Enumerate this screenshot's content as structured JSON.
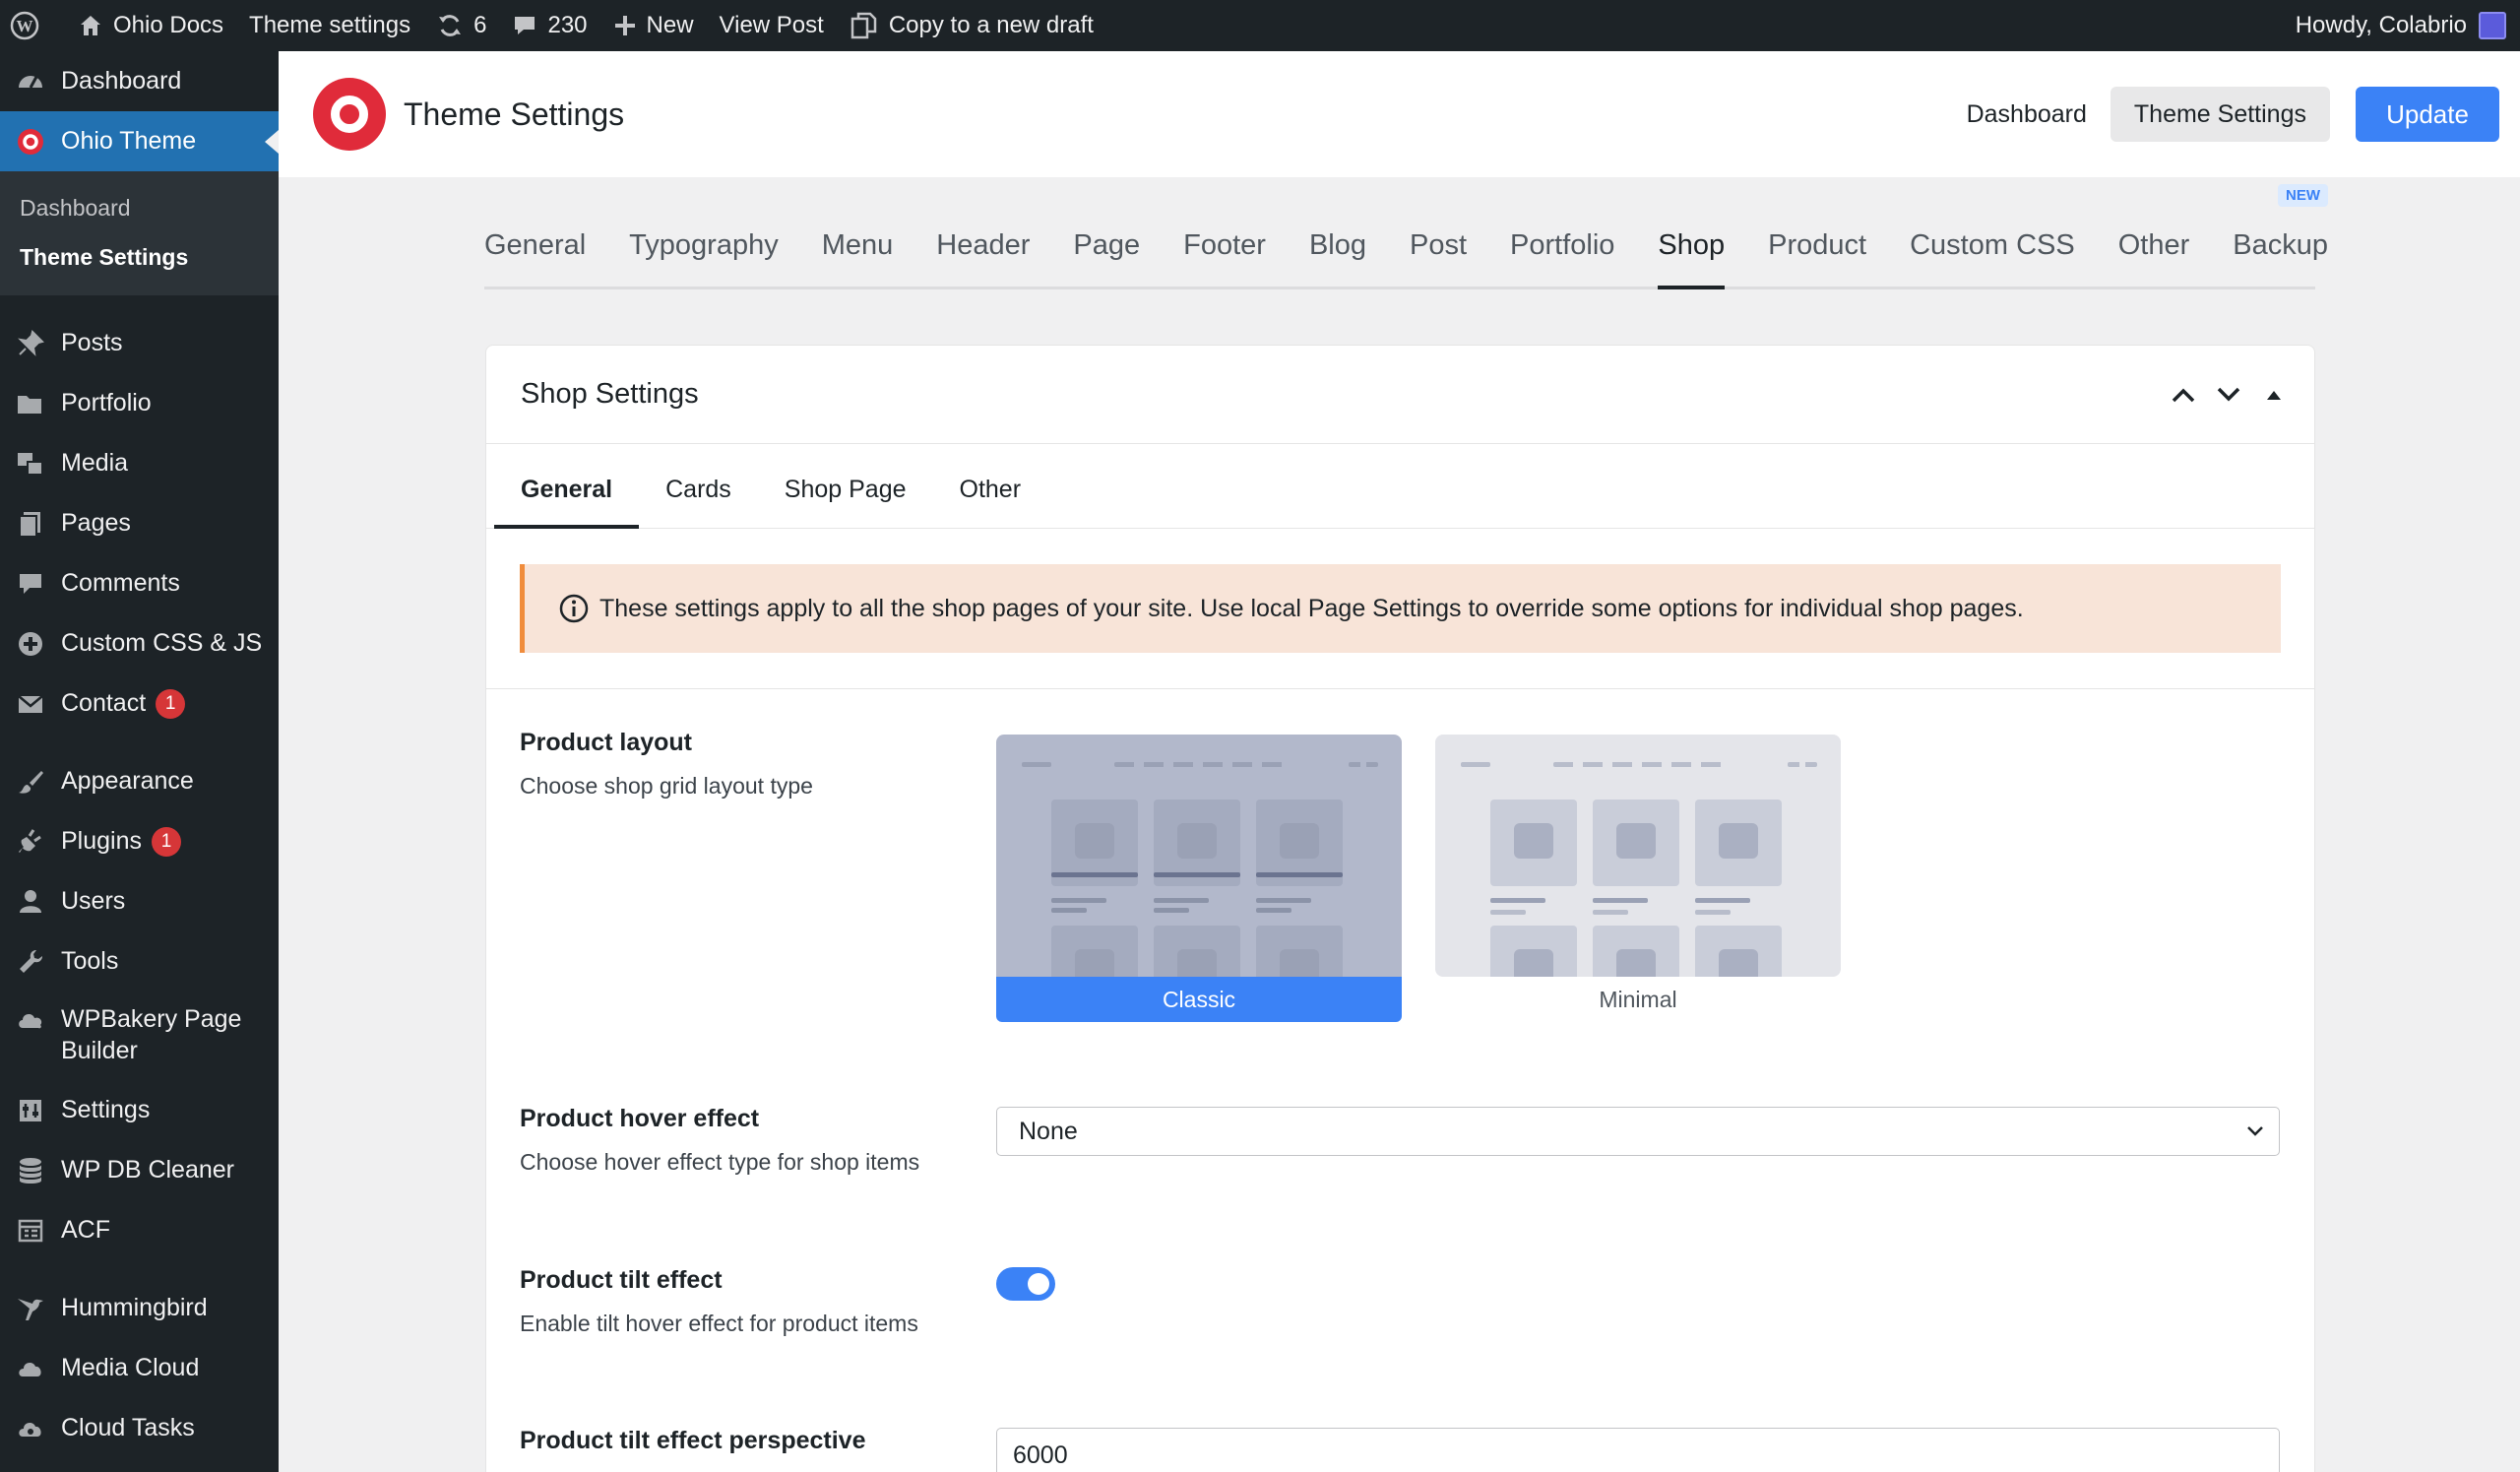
{
  "adminbar": {
    "site_name": "Ohio Docs",
    "theme_settings": "Theme settings",
    "updates_count": "6",
    "comments_count": "230",
    "new_label": "New",
    "view_post": "View Post",
    "copy_draft": "Copy to a new draft",
    "howdy": "Howdy, Colabrio"
  },
  "sidebar": {
    "dashboard": "Dashboard",
    "ohio_theme": "Ohio Theme",
    "sub_dashboard": "Dashboard",
    "sub_theme_settings": "Theme Settings",
    "posts": "Posts",
    "portfolio": "Portfolio",
    "media": "Media",
    "pages": "Pages",
    "comments": "Comments",
    "custom_css_js": "Custom CSS & JS",
    "contact": "Contact",
    "contact_badge": "1",
    "appearance": "Appearance",
    "plugins": "Plugins",
    "plugins_badge": "1",
    "users": "Users",
    "tools": "Tools",
    "wpbakery_line1": "WPBakery Page",
    "wpbakery_line2": "Builder",
    "settings": "Settings",
    "wp_db_cleaner": "WP DB Cleaner",
    "acf": "ACF",
    "hummingbird": "Hummingbird",
    "media_cloud": "Media Cloud",
    "cloud_tasks": "Cloud Tasks"
  },
  "header": {
    "title": "Theme Settings",
    "nav_dashboard": "Dashboard",
    "nav_theme_settings": "Theme Settings",
    "update_button": "Update"
  },
  "tabs": [
    "General",
    "Typography",
    "Menu",
    "Header",
    "Page",
    "Footer",
    "Blog",
    "Post",
    "Portfolio",
    "Shop",
    "Product",
    "Custom CSS",
    "Other",
    "Backup"
  ],
  "tabs_active": "Shop",
  "new_badge": "NEW",
  "panel": {
    "title": "Shop Settings",
    "subtabs": [
      "General",
      "Cards",
      "Shop Page",
      "Other"
    ],
    "notice": "These settings apply to all the shop pages of your site. Use local Page Settings to override some options for individual shop pages.",
    "product_layout": {
      "label": "Product layout",
      "desc": "Choose shop grid layout type",
      "option_classic": "Classic",
      "option_minimal": "Minimal",
      "selected": "Classic"
    },
    "hover_effect": {
      "label": "Product hover effect",
      "desc": "Choose hover effect type for shop items",
      "value": "None"
    },
    "tilt_effect": {
      "label": "Product tilt effect",
      "desc": "Enable tilt hover effect for product items",
      "enabled": true
    },
    "tilt_perspective": {
      "label": "Product tilt effect perspective",
      "value": "6000"
    }
  },
  "colors": {
    "accent": "#3b82f6",
    "admin_bg": "#1d2327",
    "active_menu": "#2271b1",
    "brand_red": "#e02b3a",
    "notice_bg": "#f8e4d8",
    "notice_border": "#f08c3c"
  }
}
